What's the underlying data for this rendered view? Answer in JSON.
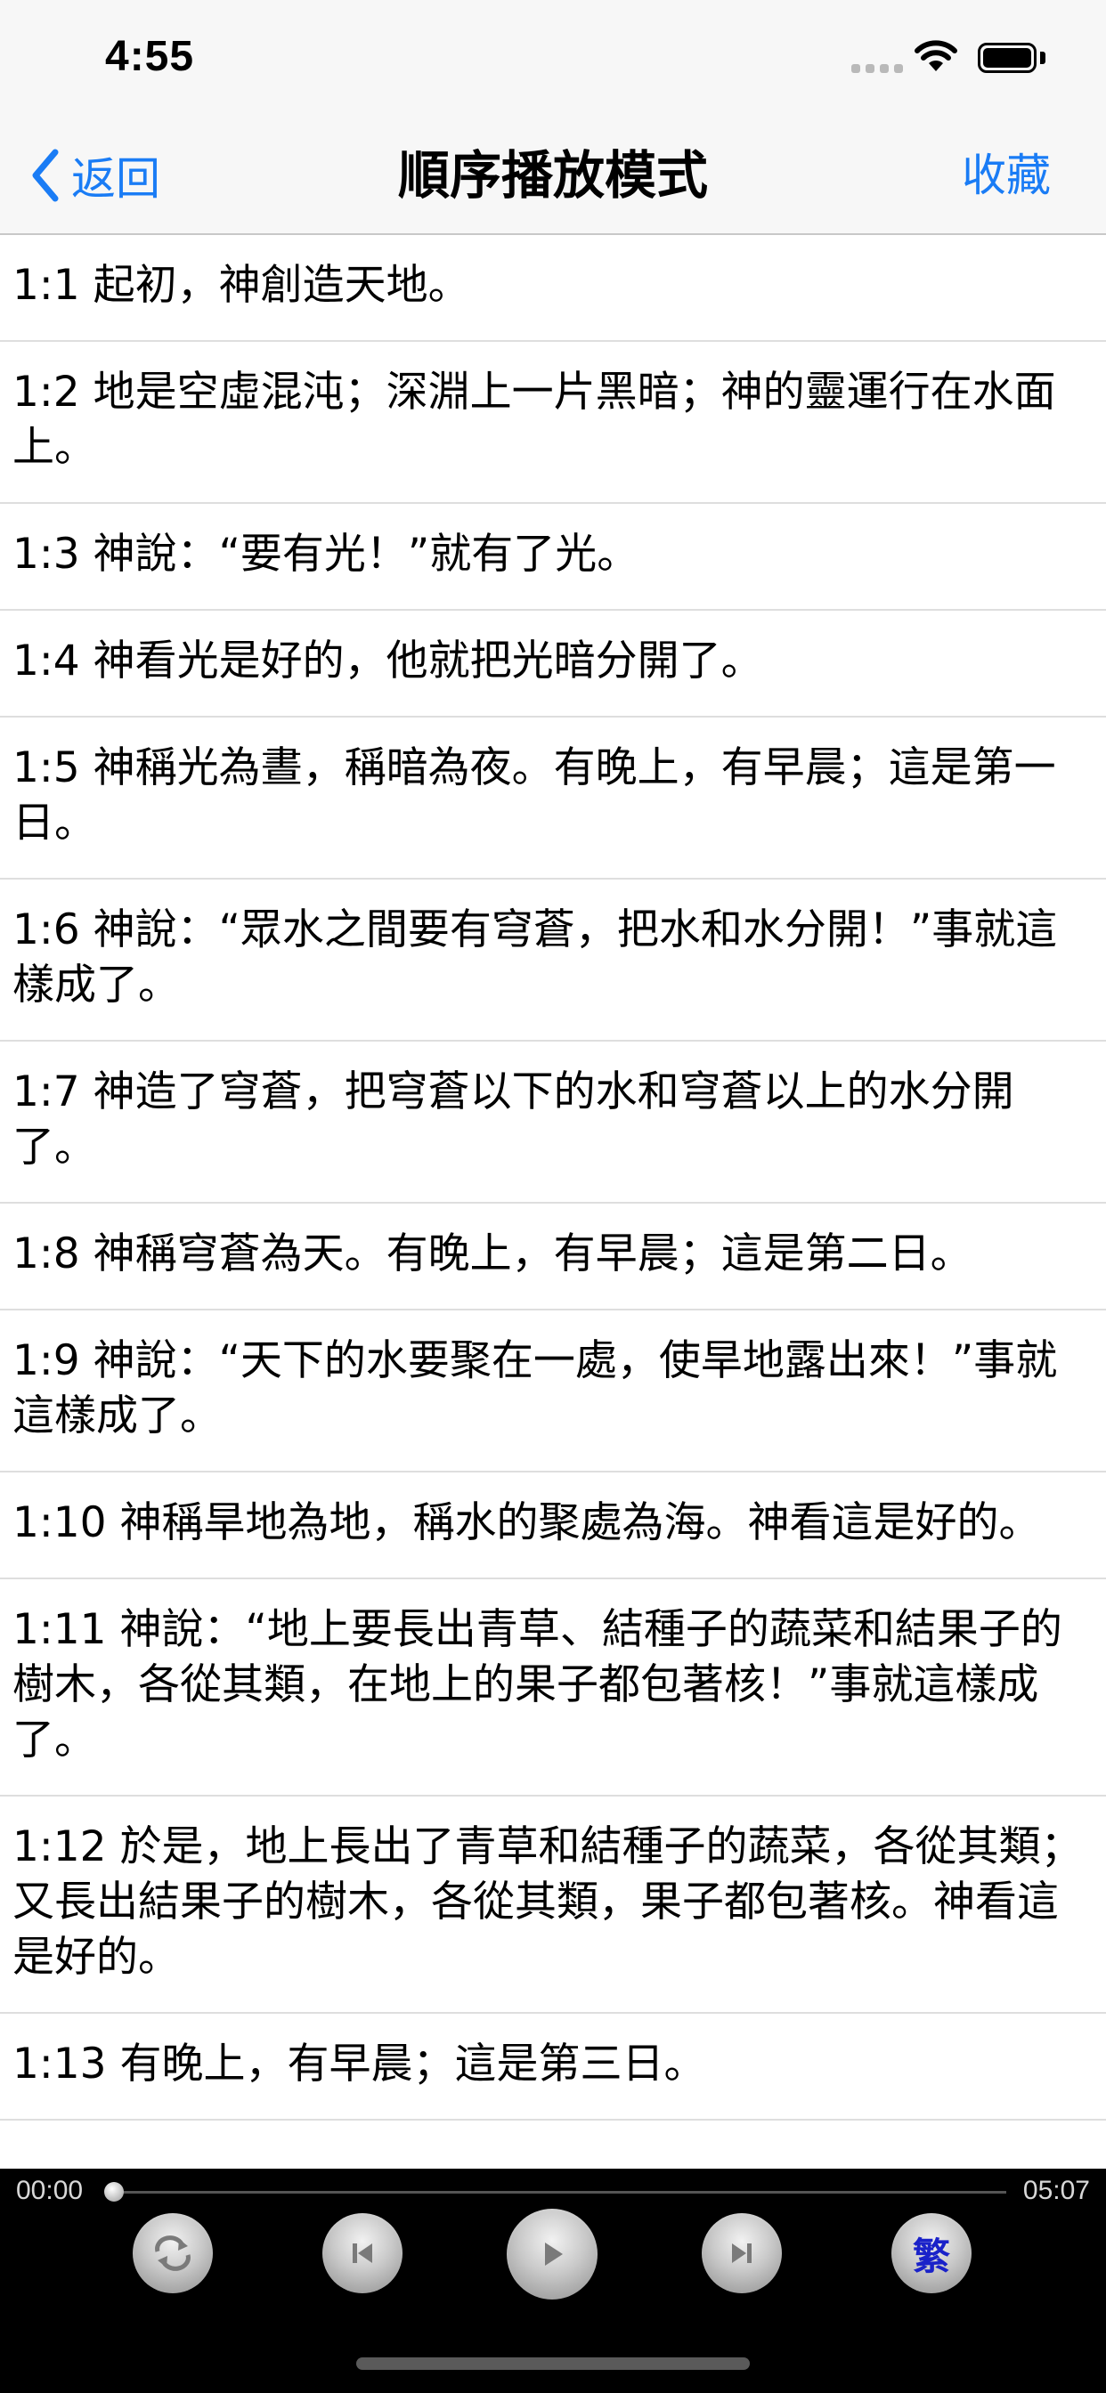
{
  "status_bar": {
    "time": "4:55"
  },
  "nav": {
    "back_label": "返回",
    "title": "順序播放模式",
    "favorite_label": "收藏"
  },
  "verses": [
    "1:1 起初，神創造天地。",
    "1:2 地是空虛混沌；深淵上一片黑暗；神的靈運行在水面上。",
    "1:3 神說：“要有光！”就有了光。",
    "1:4 神看光是好的，他就把光暗分開了。",
    "1:5 神稱光為晝，稱暗為夜。有晚上，有早晨；這是第一日。",
    "1:6 神說：“眾水之間要有穹蒼，把水和水分開！”事就這樣成了。",
    "1:7 神造了穹蒼，把穹蒼以下的水和穹蒼以上的水分開了。",
    "1:8 神稱穹蒼為天。有晚上，有早晨；這是第二日。",
    "1:9 神說：“天下的水要聚在一處，使旱地露出來！”事就這樣成了。",
    "1:10 神稱旱地為地，稱水的聚處為海。神看這是好的。",
    "1:11 神說：“地上要長出青草、結種子的蔬菜和結果子的樹木，各從其類，在地上的果子都包著核！”事就這樣成了。",
    "1:12 於是，地上長出了青草和結種子的蔬菜，各從其類；又長出結果子的樹木，各從其類，果子都包著核。神看這是好的。",
    "1:13 有晚上，有早晨；這是第三日。"
  ],
  "player": {
    "current_time": "00:00",
    "total_time": "05:07",
    "progress": 0.0,
    "lang_button": "繁",
    "icons": [
      "repeat-icon",
      "previous-icon",
      "play-icon",
      "next-icon"
    ]
  },
  "colors": {
    "accent": "#1a7cf5",
    "player_bg": "#000000",
    "lang_text": "#1a22c9"
  }
}
